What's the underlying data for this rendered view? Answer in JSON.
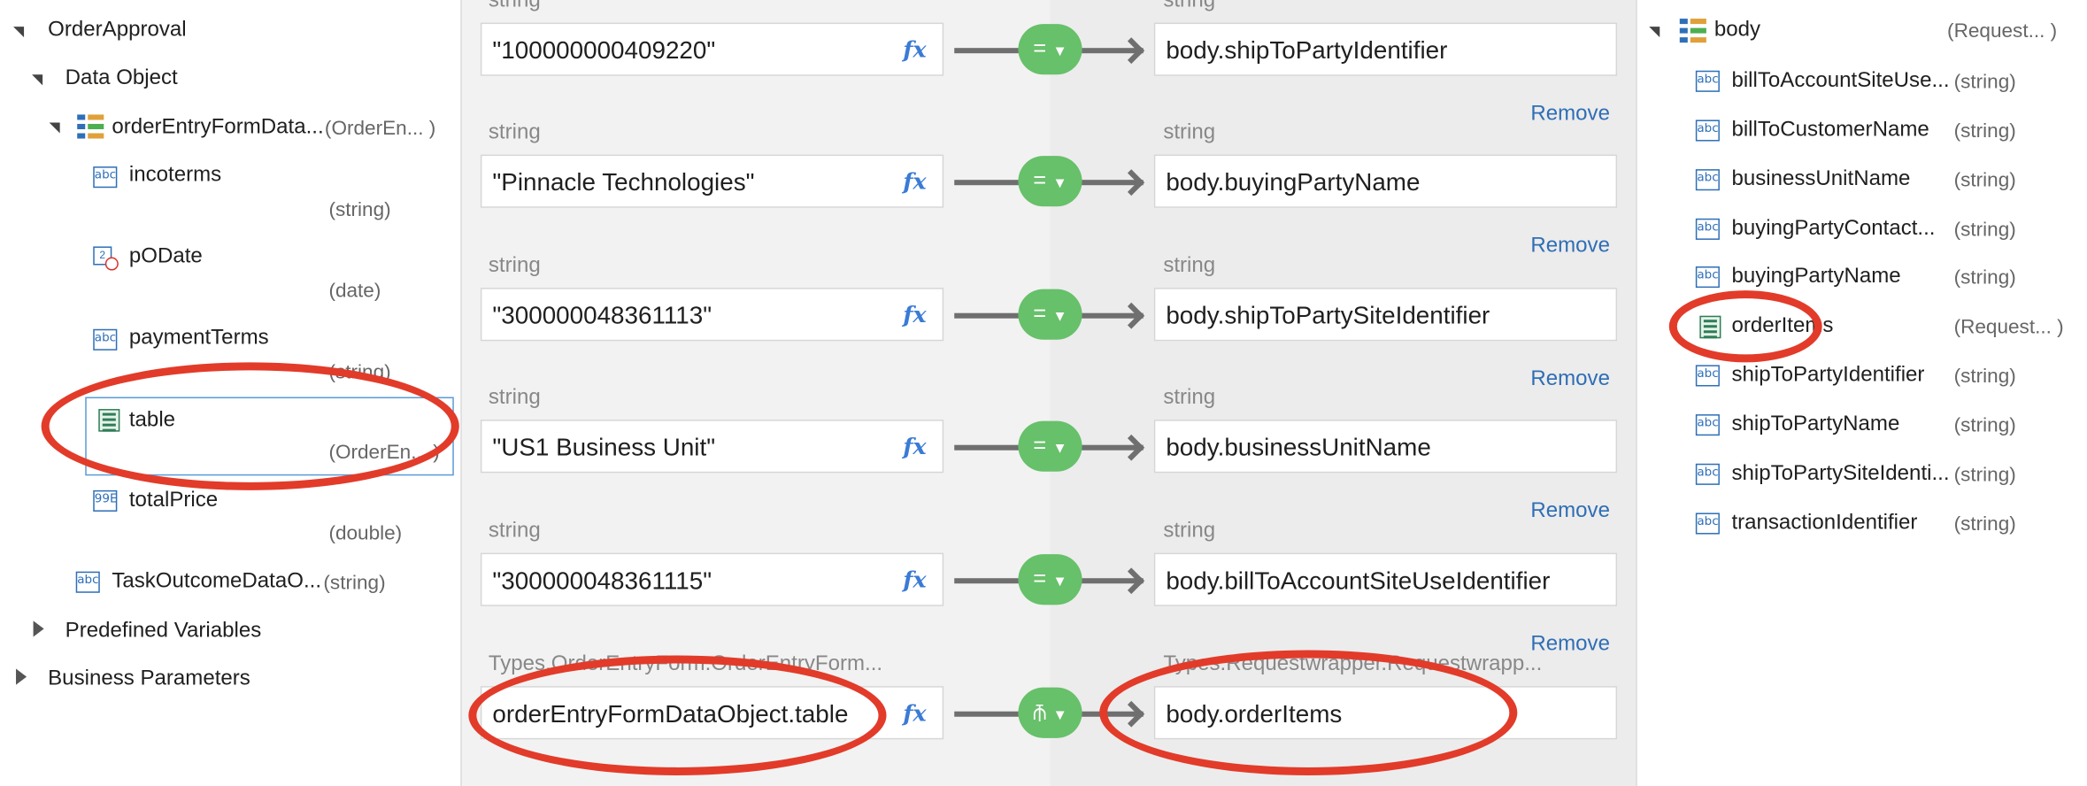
{
  "left_tree": {
    "root": "OrderApproval",
    "data_object": "Data Object",
    "form": {
      "name": "orderEntryFormData...",
      "type": "(OrderEn... )"
    },
    "fields": [
      {
        "name": "incoterms",
        "type": "(string)",
        "icon": "abc-icon"
      },
      {
        "name": "pODate",
        "type": "(date)",
        "icon": "calendar-icon"
      },
      {
        "name": "paymentTerms",
        "type": "(string)",
        "icon": "abc-icon"
      },
      {
        "name": "table",
        "type": "(OrderEn... )",
        "icon": "table-icon"
      },
      {
        "name": "totalPrice",
        "type": "(double)",
        "icon": "number-icon"
      }
    ],
    "task_outcome": {
      "name": "TaskOutcomeDataO...",
      "type": "(string)"
    },
    "predefined": "Predefined Variables",
    "business": "Business Parameters"
  },
  "mappings": [
    {
      "src_type": "string",
      "source": "\"100000000409220\"",
      "tgt_type": "string",
      "target": "body.shipToPartyIdentifier",
      "remove": "Remove",
      "op": "="
    },
    {
      "src_type": "string",
      "source": "\"Pinnacle Technologies\"",
      "tgt_type": "string",
      "target": "body.buyingPartyName",
      "remove": "Remove",
      "op": "="
    },
    {
      "src_type": "string",
      "source": "\"300000048361113\"",
      "tgt_type": "string",
      "target": "body.shipToPartySiteIdentifier",
      "remove": "Remove",
      "op": "="
    },
    {
      "src_type": "string",
      "source": "\"US1 Business Unit\"",
      "tgt_type": "string",
      "target": "body.businessUnitName",
      "remove": "Remove",
      "op": "="
    },
    {
      "src_type": "string",
      "source": "\"300000048361115\"",
      "tgt_type": "string",
      "target": "body.billToAccountSiteUseIdentifier",
      "remove": "Remove",
      "op": "="
    },
    {
      "src_type": "Types.OrderEntryForm.OrderEntryForm...",
      "source": "orderEntryFormDataObject.table",
      "tgt_type": "Types.Requestwrapper.Requestwrapp...",
      "target": "body.orderItems",
      "remove": "",
      "op": "⫚"
    }
  ],
  "fx_label": "fx",
  "right_tree": {
    "root": {
      "name": "body",
      "type": "(Request... )"
    },
    "items": [
      {
        "name": "billToAccountSiteUse...",
        "type": "(string)"
      },
      {
        "name": "billToCustomerName",
        "type": "(string)"
      },
      {
        "name": "businessUnitName",
        "type": "(string)"
      },
      {
        "name": "buyingPartyContact...",
        "type": "(string)"
      },
      {
        "name": "buyingPartyName",
        "type": "(string)"
      },
      {
        "name": "orderItems",
        "type": "(Request... )"
      },
      {
        "name": "shipToPartyIdentifier",
        "type": "(string)"
      },
      {
        "name": "shipToPartyName",
        "type": "(string)"
      },
      {
        "name": "shipToPartySiteIdenti...",
        "type": "(string)"
      },
      {
        "name": "transactionIdentifier",
        "type": "(string)"
      }
    ]
  },
  "colors": {
    "accent": "#2f6eb5",
    "pill": "#67c06a",
    "highlight": "#e23b2a"
  }
}
